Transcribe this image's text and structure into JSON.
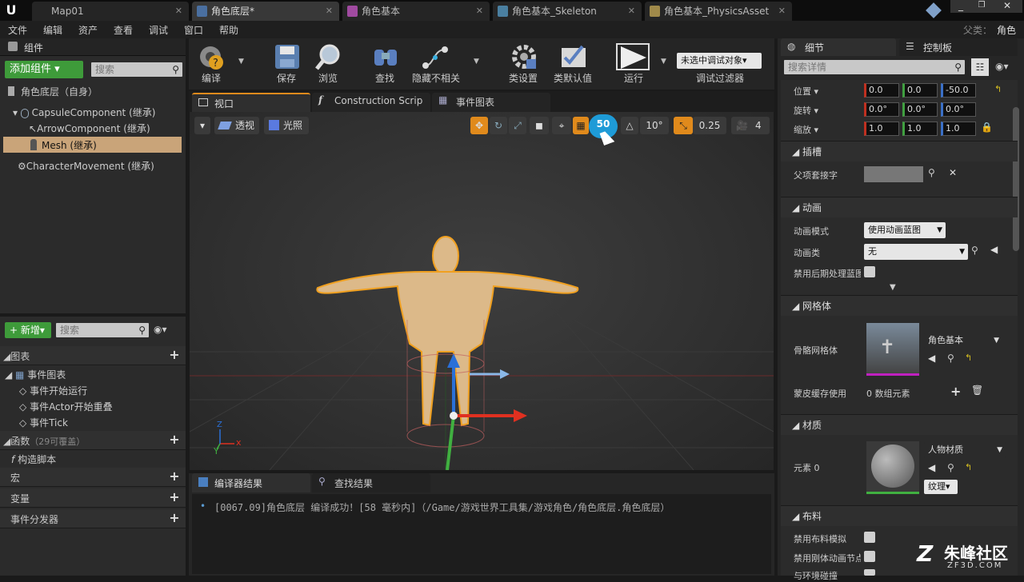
{
  "window": {
    "tabs": [
      {
        "label": "Map01"
      },
      {
        "label": "角色底层*"
      },
      {
        "label": "角色基本"
      },
      {
        "label": "角色基本_Skeleton"
      },
      {
        "label": "角色基本_PhysicsAsset"
      }
    ],
    "parent_label": "父类：",
    "parent_value": "角色"
  },
  "menu": [
    "文件",
    "编辑",
    "资产",
    "查看",
    "调试",
    "窗口",
    "帮助"
  ],
  "components": {
    "title": "组件",
    "add_button": "添加组件",
    "search_placeholder": "搜索",
    "root": "角色底层（自身）",
    "items": [
      "CapsuleComponent (继承)",
      "ArrowComponent (继承)",
      "Mesh (继承)",
      "CharacterMovement (继承)"
    ]
  },
  "toolbar": {
    "buttons": [
      "编译",
      "保存",
      "浏览",
      "查找",
      "隐藏不相关",
      "类设置",
      "类默认值",
      "运行"
    ],
    "debug_select": "未选中调试对象▾",
    "debug_filter": "调试过滤器"
  },
  "editor_tabs": [
    "视口",
    "Construction Scrip",
    "事件图表"
  ],
  "viewport": {
    "perspective": "透视",
    "lit": "光照",
    "grid_snap": "50",
    "rot_snap": "10°",
    "scale_snap": "0.25",
    "cam_speed": "4",
    "axis_x": "x",
    "axis_y": "Y",
    "axis_z": "Z"
  },
  "mybp": {
    "new_button": "新增",
    "search_placeholder": "搜索",
    "graphs": "图表",
    "event_graph": "事件图表",
    "events": [
      "事件开始运行",
      "事件Actor开始重叠",
      "事件Tick"
    ],
    "functions": "函数",
    "functions_note": "（29可覆盖）",
    "construct": "构造脚本",
    "macros": "宏",
    "variables": "变量",
    "dispatchers": "事件分发器"
  },
  "output": {
    "tabs": [
      "编译器结果",
      "查找结果"
    ],
    "message": "[0067.09]角色底层 编译成功！[58 毫秒内]（/Game/游戏世界工具集/游戏角色/角色底层.角色底层）"
  },
  "details": {
    "tabs": [
      "细节",
      "控制板"
    ],
    "search_placeholder": "搜索详情",
    "location_label": "位置 ▾",
    "location": [
      "0.0",
      "0.0",
      "-50.0"
    ],
    "rotation_label": "旋转 ▾",
    "rotation": [
      "0.0°",
      "0.0°",
      "0.0°"
    ],
    "scale_label": "缩放 ▾",
    "scale": [
      "1.0",
      "1.0",
      "1.0"
    ],
    "socket_section": "插槽",
    "parent_socket": "父项套接字",
    "anim_section": "动画",
    "anim_mode_label": "动画模式",
    "anim_mode": "使用动画蓝图",
    "anim_class_label": "动画类",
    "anim_class": "无",
    "disable_post": "禁用后期处理蓝图",
    "mesh_section": "网格体",
    "skeletal_mesh_label": "骨骼网格体",
    "skeletal_mesh": "角色基本",
    "skin_cache_label": "蒙皮缓存使用",
    "skin_cache_value": "0 数组元素",
    "material_section": "材质",
    "element0": "元素 0",
    "material": "人物材质",
    "texture": "纹理▾",
    "cloth_section": "布料",
    "disable_cloth": "禁用布料模拟",
    "disable_rigid": "禁用刚体动画节点",
    "env_collision": "与环境碰撞"
  },
  "watermark": {
    "text": "朱峰社区",
    "url": "ZF3D.COM"
  },
  "colors": {
    "accent_green": "#3e9b3a",
    "accent_orange": "#e08a1c",
    "selection": "#c9a479",
    "snap_blue": "#1e9bd7"
  }
}
